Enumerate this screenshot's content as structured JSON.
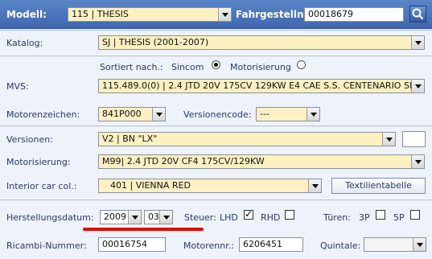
{
  "header": {
    "modell_label": "Modell:",
    "modell_value": "115 | THESIS",
    "fahrgestell_label": "Fahrgestellnr.:",
    "fahrgestell_value": "00018679"
  },
  "katalog": {
    "label": "Katalog:",
    "value": "SJ | THESIS (2001-2007)"
  },
  "mvs": {
    "sort_label": "Sortiert nach.:",
    "opt_sincom": "Sincom",
    "opt_motorisierung": "Motorisierung",
    "label": "MVS:",
    "value": "115.489.0(0) | 2.4 JTD 20V 175CV 129KW E4 CAE S.S. CENTENARIO SPORTIV...",
    "motorzeichen_label": "Motorenzeichen:",
    "motorzeichen_value": "841P000",
    "versionencode_label": "Versionencode:",
    "versionencode_value": "---"
  },
  "versionen": {
    "label": "Versionen:",
    "value": "V2 | BN \"LX\"",
    "motorisierung_label": "Motorisierung:",
    "motorisierung_value": "M99| 2.4 JTD 20V CF4 175CV/129KW",
    "interior_label": "Interior car col.:",
    "interior_value": "401 | VIENNA RED",
    "textil_button": "Textilientabelle"
  },
  "details": {
    "herstellung_label": "Herstellungsdatum:",
    "year": "2009",
    "month": "03",
    "steuer_label": "Steuer:",
    "lhd": "LHD",
    "rhd": "RHD",
    "tueren_label": "Türen:",
    "tueren_3p": "3P",
    "tueren_5p": "5P",
    "ricambi_label": "Ricambi-Nummer:",
    "ricambi_value": "00016754",
    "motorennr_label": "Motorennr.:",
    "motorennr_value": "6206451",
    "quintale_label": "Quintale:",
    "quintale_value": ""
  },
  "colors": {
    "header_bg": "#4a77bd",
    "field_bg": "#fdf0c2",
    "highlight": "#e00000"
  }
}
